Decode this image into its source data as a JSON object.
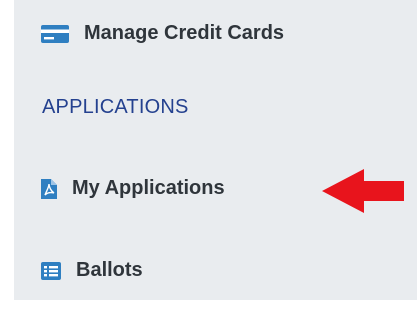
{
  "sidebar": {
    "items": [
      {
        "label": "Manage Credit Cards",
        "icon": "credit-card-icon"
      },
      {
        "label": "My Applications",
        "icon": "pdf-file-icon"
      },
      {
        "label": "Ballots",
        "icon": "list-icon"
      }
    ],
    "section_heading": "APPLICATIONS"
  },
  "annotation": {
    "icon": "red-arrow-icon",
    "color": "#e8141c"
  },
  "colors": {
    "icon_blue": "#2f7fc1",
    "section_heading": "#24418f",
    "panel_bg": "#e9ecef"
  }
}
